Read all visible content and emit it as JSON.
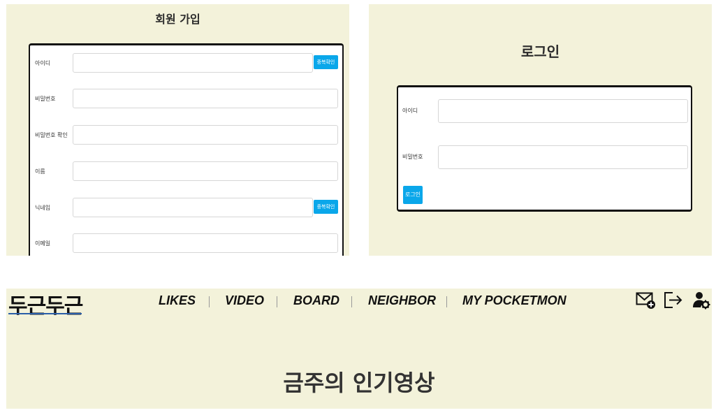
{
  "signup": {
    "title": "회원 가입",
    "fields": [
      {
        "label": "아이디",
        "value": "",
        "button": "중복확인"
      },
      {
        "label": "비밀번호",
        "value": ""
      },
      {
        "label": "비밀번호 확인",
        "value": ""
      },
      {
        "label": "이름",
        "value": ""
      },
      {
        "label": "닉네임",
        "value": "",
        "button": "중복확인"
      },
      {
        "label": "이메일",
        "value": ""
      }
    ]
  },
  "login": {
    "title": "로그인",
    "fields": [
      {
        "label": "아이디",
        "value": ""
      },
      {
        "label": "비밀번호",
        "value": ""
      }
    ],
    "button": "로그인"
  },
  "header": {
    "logo": "두근두근",
    "nav": [
      "LIKES",
      "VIDEO",
      "BOARD",
      "NEIGHBOR",
      "MY POCKETMON"
    ],
    "icons": [
      "mail-add-icon",
      "logout-icon",
      "user-settings-icon"
    ]
  },
  "main": {
    "heading": "금주의 인기영상"
  },
  "colors": {
    "panel_bg": "#f3f2da",
    "accent_button": "#0aa7ea",
    "logo_underline": "#2a5ea8"
  }
}
